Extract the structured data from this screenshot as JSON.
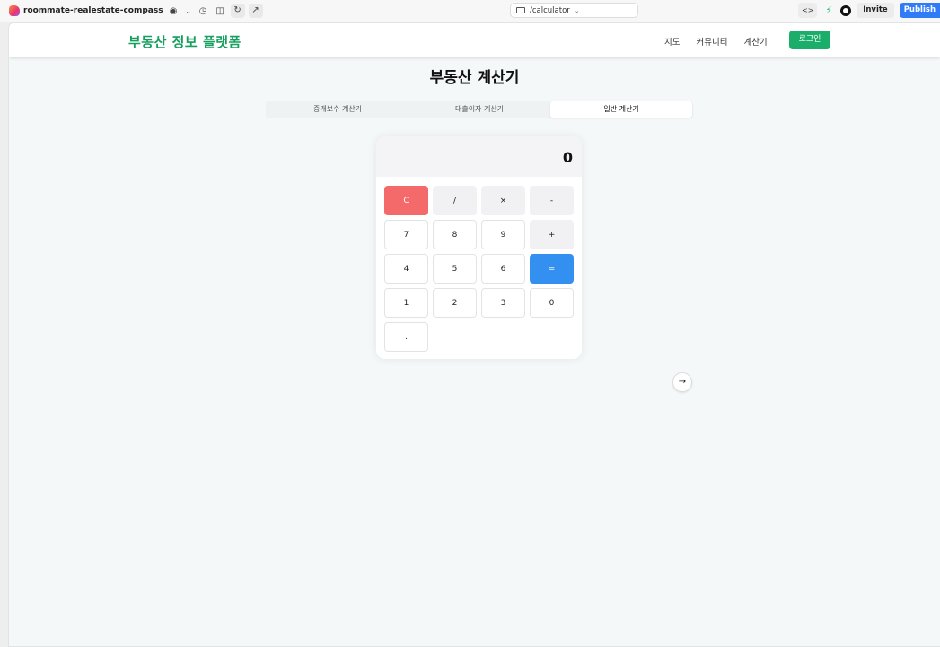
{
  "editor": {
    "project_name": "roommate-realestate-compass",
    "url_path": "/calculator",
    "invite_label": "Invite",
    "publish_label": "Publish"
  },
  "site": {
    "logo": "부동산 정보 플랫폼",
    "nav": [
      "지도",
      "커뮤니티",
      "계산기"
    ],
    "login_label": "로그인",
    "brand_color": "#169f5f"
  },
  "page": {
    "title": "부동산 계산기",
    "tabs": [
      {
        "label": "중개보수 계산기",
        "active": false
      },
      {
        "label": "대출이자 계산기",
        "active": false
      },
      {
        "label": "일반 계산기",
        "active": true
      }
    ]
  },
  "calculator": {
    "display": "0",
    "keys": [
      "C",
      "/",
      "×",
      "-",
      "7",
      "8",
      "9",
      "+",
      "4",
      "5",
      "6",
      "=",
      "1",
      "2",
      "3",
      "0",
      "."
    ]
  }
}
